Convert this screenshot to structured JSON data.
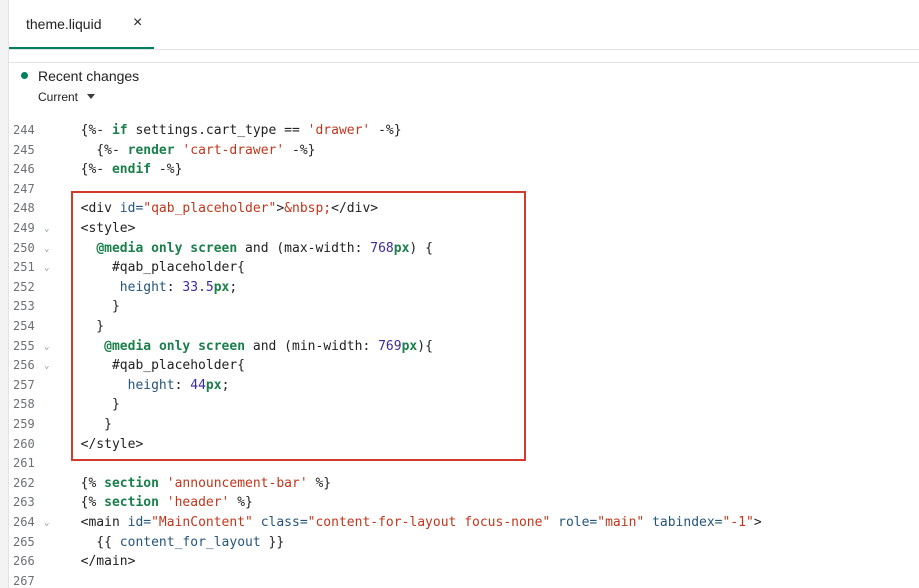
{
  "tab": {
    "label": "theme.liquid",
    "close": "×"
  },
  "header": {
    "title": "Recent changes",
    "version": "Current"
  },
  "colors": {
    "accent": "#008060",
    "highlight_border": "#d23a2b"
  },
  "editor": {
    "partial_top_line": "243",
    "lines": [
      {
        "num": "244",
        "fold": false
      },
      {
        "num": "245",
        "fold": false
      },
      {
        "num": "246",
        "fold": false
      },
      {
        "num": "247",
        "fold": false
      },
      {
        "num": "248",
        "fold": false
      },
      {
        "num": "249",
        "fold": true
      },
      {
        "num": "250",
        "fold": true
      },
      {
        "num": "251",
        "fold": true
      },
      {
        "num": "252",
        "fold": false
      },
      {
        "num": "253",
        "fold": false
      },
      {
        "num": "254",
        "fold": false
      },
      {
        "num": "255",
        "fold": true
      },
      {
        "num": "256",
        "fold": true
      },
      {
        "num": "257",
        "fold": false
      },
      {
        "num": "258",
        "fold": false
      },
      {
        "num": "259",
        "fold": false
      },
      {
        "num": "260",
        "fold": false
      },
      {
        "num": "261",
        "fold": false
      },
      {
        "num": "262",
        "fold": false
      },
      {
        "num": "263",
        "fold": false
      },
      {
        "num": "264",
        "fold": true
      },
      {
        "num": "265",
        "fold": false
      },
      {
        "num": "266",
        "fold": false
      },
      {
        "num": "267",
        "fold": false
      }
    ],
    "code": [
      [
        [
          "t",
          "  {%- "
        ],
        [
          "kw",
          "if"
        ],
        [
          "t",
          " settings.cart_type == "
        ],
        [
          "str",
          "'drawer'"
        ],
        [
          "t",
          " -%}"
        ]
      ],
      [
        [
          "t",
          "    {%- "
        ],
        [
          "kw",
          "render"
        ],
        [
          "t",
          " "
        ],
        [
          "str",
          "'cart-drawer'"
        ],
        [
          "t",
          " -%}"
        ]
      ],
      [
        [
          "t",
          "  {%- "
        ],
        [
          "kw",
          "endif"
        ],
        [
          "t",
          " -%}"
        ]
      ],
      [],
      [
        [
          "t",
          "  <div "
        ],
        [
          "attr",
          "id="
        ],
        [
          "str",
          "\"qab_placeholder\""
        ],
        [
          "t",
          ">"
        ],
        [
          "str",
          "&nbsp;"
        ],
        [
          "t",
          "</div>"
        ]
      ],
      [
        [
          "t",
          "  <style>"
        ]
      ],
      [
        [
          "t",
          "    "
        ],
        [
          "kw",
          "@media"
        ],
        [
          "t",
          " "
        ],
        [
          "kw",
          "only"
        ],
        [
          "t",
          " "
        ],
        [
          "kw",
          "screen"
        ],
        [
          "t",
          " and (max-width: "
        ],
        [
          "num",
          "768"
        ],
        [
          "kw",
          "px"
        ],
        [
          "t",
          ") {"
        ]
      ],
      [
        [
          "t",
          "      #qab_placeholder{"
        ]
      ],
      [
        [
          "t",
          "       "
        ],
        [
          "attr",
          "height"
        ],
        [
          "t",
          ": "
        ],
        [
          "num",
          "33.5"
        ],
        [
          "kw",
          "px"
        ],
        [
          "t",
          ";"
        ]
      ],
      [
        [
          "t",
          "      }"
        ]
      ],
      [
        [
          "t",
          "    }"
        ]
      ],
      [
        [
          "t",
          "     "
        ],
        [
          "kw",
          "@media"
        ],
        [
          "t",
          " "
        ],
        [
          "kw",
          "only"
        ],
        [
          "t",
          " "
        ],
        [
          "kw",
          "screen"
        ],
        [
          "t",
          " and (min-width: "
        ],
        [
          "num",
          "769"
        ],
        [
          "kw",
          "px"
        ],
        [
          "t",
          "){"
        ]
      ],
      [
        [
          "t",
          "      #qab_placeholder{"
        ]
      ],
      [
        [
          "t",
          "        "
        ],
        [
          "attr",
          "height"
        ],
        [
          "t",
          ": "
        ],
        [
          "num",
          "44"
        ],
        [
          "kw",
          "px"
        ],
        [
          "t",
          ";"
        ]
      ],
      [
        [
          "t",
          "      }"
        ]
      ],
      [
        [
          "t",
          "     }"
        ]
      ],
      [
        [
          "t",
          "  </style>"
        ]
      ],
      [],
      [
        [
          "t",
          "  {% "
        ],
        [
          "kw",
          "section"
        ],
        [
          "t",
          " "
        ],
        [
          "str",
          "'announcement-bar'"
        ],
        [
          "t",
          " %}"
        ]
      ],
      [
        [
          "t",
          "  {% "
        ],
        [
          "kw",
          "section"
        ],
        [
          "t",
          " "
        ],
        [
          "str",
          "'header'"
        ],
        [
          "t",
          " %}"
        ]
      ],
      [
        [
          "t",
          "  <main "
        ],
        [
          "attr",
          "id="
        ],
        [
          "str",
          "\"MainContent\""
        ],
        [
          "t",
          " "
        ],
        [
          "attr",
          "class="
        ],
        [
          "str",
          "\"content-for-layout focus-none\""
        ],
        [
          "t",
          " "
        ],
        [
          "attr",
          "role="
        ],
        [
          "str",
          "\"main\""
        ],
        [
          "t",
          " "
        ],
        [
          "attr",
          "tabindex="
        ],
        [
          "str",
          "\"-1\""
        ],
        [
          "t",
          ">"
        ]
      ],
      [
        [
          "t",
          "    {{ "
        ],
        [
          "attr",
          "content_for_layout"
        ],
        [
          "t",
          " }}"
        ]
      ],
      [
        [
          "t",
          "  </main>"
        ]
      ],
      []
    ]
  }
}
